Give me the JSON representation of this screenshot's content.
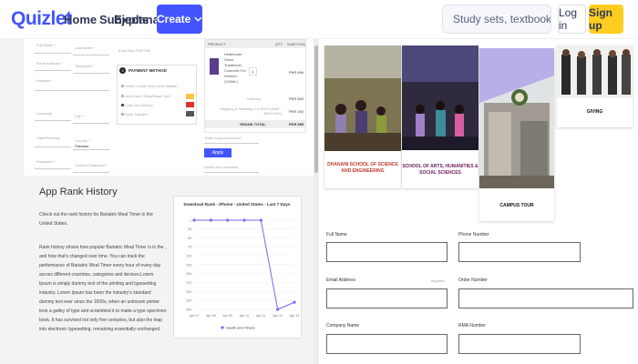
{
  "header": {
    "logo": "Quizlet",
    "nav": [
      "Home",
      "Subjects",
      "Explanations"
    ],
    "create_label": "Create",
    "search_placeholder": "Study sets, textbooks, ...",
    "login_label": "Log in",
    "signup_label": "Sign up",
    "colors": {
      "brand": "#4255ff",
      "signup": "#ffcd1f"
    }
  },
  "checkout": {
    "fields": [
      "Full Name *",
      "Last Name *",
      "Email Address *",
      "Telephone *",
      "Address *",
      "Company",
      "City *",
      "State/Province",
      "Country *",
      "Password *",
      "Confirm Password *"
    ],
    "country_value": "Pakistan",
    "track_label": "Track Now PKR 000",
    "payment_title": "PAYMENT METHOD",
    "payment_options": [
      "Debit / Credit Card (Visa Master)",
      "JazzCash / EasyPaisa Card",
      "Cash on Delivery",
      "Bank Transfer"
    ],
    "product_headers": [
      "PRODUCT",
      "QTY",
      "SUBTOTAL"
    ],
    "product_name": "Healthcare Gloss Traditional Cosmetic For Women (100ML)",
    "product_qty": "1",
    "product_price": "PKR 699",
    "subtotal_label": "Subtotal",
    "subtotal_value": "PKR 600",
    "shipping_label": "Shipping & Handling 1-3 DAYS (ANP - 3000 KMS)",
    "shipping_value": "PKR 200",
    "grand_label": "GRAND TOTAL",
    "grand_value": "PKR 899",
    "coupon_label": "Enter coupon/voucher",
    "apply_label": "Apply",
    "note_label": "Leave your comment"
  },
  "rank": {
    "title": "App Rank History",
    "intro": "Check out the rank history for Bariatric Meal Timer in the United States.",
    "body": "Rank history shows how popular Bariatric Meal Timer is in the , and how that's changed over time. You can track the performance of Bariatric Meal Timer every hour of every day across different countries, categories and devices.Lorem Ipsum is simply dummy text of the printing and typesetting industry. Lorem Ipsum has been the industry's standard dummy text ever since the 1500s, when an unknown printer took a galley of type and scrambled it to make a type specimen book. It has survived not only five centuries, but also the leap into electronic typesetting, remaining essentially unchanged."
  },
  "chart_data": {
    "type": "line",
    "title": "Download Rank - iPhone - United States - Last 7 Days",
    "categories": [
      "Apr 07",
      "Apr 08",
      "Apr 09",
      "Apr 10",
      "Apr 11",
      "Apr 12",
      "Apr 13"
    ],
    "series": [
      {
        "name": "Health and Fitness",
        "values": [
          1,
          1,
          1,
          1,
          1,
          250,
          230
        ]
      }
    ],
    "yticks": [
      "1",
      "25",
      "50",
      "75",
      "100",
      "125",
      "150",
      "175",
      "200",
      "225",
      "250"
    ],
    "ylim": [
      1,
      250
    ],
    "y_reversed": true,
    "color": "#7b68ee",
    "legend": "bottom"
  },
  "schools": [
    {
      "label": "DHANANI SCHOOL OF SCIENCE AND ENGINEERING",
      "color": "#c0392b"
    },
    {
      "label": "SCHOOL OF ARTS, HUMANITIES & SOCIAL SCIENCES",
      "color": "#6b1d5e"
    },
    {
      "label": "CAMPUS TOUR",
      "color": "#111111"
    },
    {
      "label": "GIVING",
      "color": "#111111"
    }
  ],
  "contact_form": {
    "labels": [
      "Full Name",
      "Phone Number",
      "Email Address",
      "Order Number",
      "Company Name",
      "RMA Number"
    ],
    "required_note": "required"
  }
}
